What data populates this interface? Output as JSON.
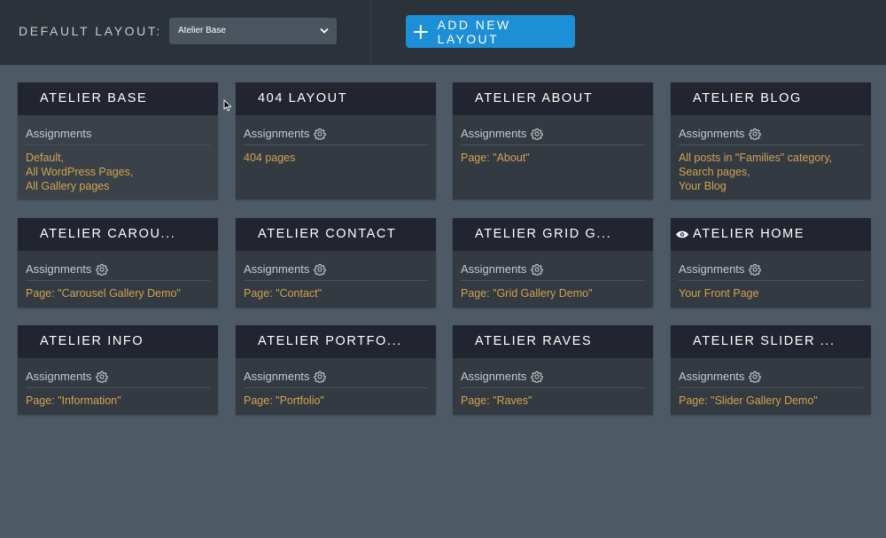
{
  "header": {
    "default_label": "DEFAULT LAYOUT:",
    "selected_layout": "Atelier Base",
    "add_button_label": "ADD NEW LAYOUT"
  },
  "assignments_label": "Assignments",
  "colors": {
    "accent_button": "#1c8fd6",
    "assignment_text": "#d2a24e",
    "card_header": "#22252f"
  },
  "cards": [
    {
      "title": "ATELIER BASE",
      "assignments": [
        "Default,",
        "All WordPress Pages,",
        "All Gallery pages"
      ]
    },
    {
      "title": "404 LAYOUT",
      "assignments": [
        "404 pages"
      ]
    },
    {
      "title": "ATELIER ABOUT",
      "assignments": [
        "Page: \"About\""
      ]
    },
    {
      "title": "ATELIER BLOG",
      "assignments": [
        "All posts in \"Families\" category,",
        "Search pages,",
        "Your Blog"
      ]
    },
    {
      "title": "ATELIER CAROU...",
      "assignments": [
        "Page: \"Carousel Gallery Demo\""
      ]
    },
    {
      "title": "ATELIER CONTACT",
      "assignments": [
        "Page: \"Contact\""
      ]
    },
    {
      "title": "ATELIER GRID G...",
      "assignments": [
        "Page: \"Grid Gallery Demo\""
      ]
    },
    {
      "title": "ATELIER HOME",
      "assignments": [
        "Your Front Page"
      ]
    },
    {
      "title": "ATELIER INFO",
      "assignments": [
        "Page: \"Information\""
      ]
    },
    {
      "title": "ATELIER PORTFO...",
      "assignments": [
        "Page: \"Portfolio\""
      ]
    },
    {
      "title": "ATELIER RAVES",
      "assignments": [
        "Page: \"Raves\""
      ]
    },
    {
      "title": "ATELIER SLIDER ...",
      "assignments": [
        "Page: \"Slider Gallery Demo\""
      ]
    }
  ]
}
